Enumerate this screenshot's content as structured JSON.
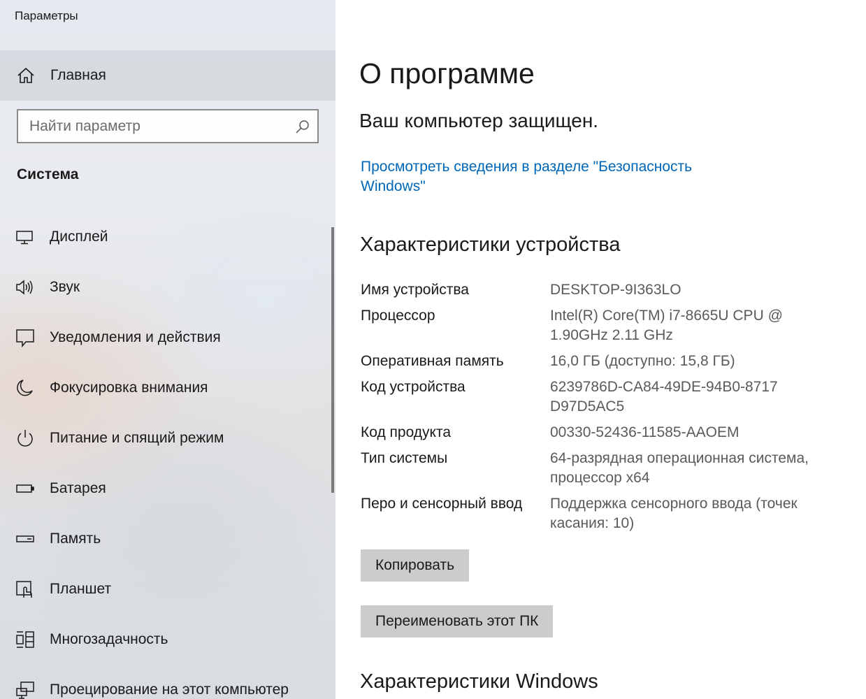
{
  "app": {
    "title": "Параметры"
  },
  "sidebar": {
    "home_label": "Главная",
    "search_placeholder": "Найти параметр",
    "section_title": "Система",
    "items": [
      {
        "label": "Дисплей",
        "icon": "display-icon"
      },
      {
        "label": "Звук",
        "icon": "speaker-icon"
      },
      {
        "label": "Уведомления и действия",
        "icon": "notification-icon"
      },
      {
        "label": "Фокусировка внимания",
        "icon": "moon-icon"
      },
      {
        "label": "Питание и спящий режим",
        "icon": "power-icon"
      },
      {
        "label": "Батарея",
        "icon": "battery-icon"
      },
      {
        "label": "Память",
        "icon": "storage-icon"
      },
      {
        "label": "Планшет",
        "icon": "tablet-icon"
      },
      {
        "label": "Многозадачность",
        "icon": "multitasking-icon"
      },
      {
        "label": "Проецирование на этот компьютер",
        "icon": "projecting-icon"
      }
    ]
  },
  "main": {
    "title": "О программе",
    "protected_text": "Ваш компьютер защищен.",
    "security_link_line1": "Просмотреть сведения в разделе \"Безопасность",
    "security_link_line2": "Windows\"",
    "device_specs_heading": "Характеристики устройства",
    "specs": [
      {
        "label": "Имя устройства",
        "value": "DESKTOP-9I363LO"
      },
      {
        "label": "Процессор",
        "value": "Intel(R) Core(TM) i7-8665U CPU @ 1.90GHz 2.11 GHz"
      },
      {
        "label": "Оперативная память",
        "value": "16,0 ГБ (доступно: 15,8 ГБ)"
      },
      {
        "label": "Код устройства",
        "value": "6239786D-CA84-49DE-94B0-8717D97D5AC5"
      },
      {
        "label": "Код продукта",
        "value": "00330-52436-11585-AAOEM"
      },
      {
        "label": "Тип системы",
        "value": "64-разрядная операционная система, процессор x64"
      },
      {
        "label": "Перо и сенсорный ввод",
        "value": "Поддержка сенсорного ввода (точек касания: 10)"
      }
    ],
    "copy_button": "Копировать",
    "rename_button": "Переименовать этот ПК",
    "windows_specs_heading": "Характеристики Windows"
  },
  "colors": {
    "link": "#0067b8",
    "button_bg": "#cccccc",
    "value_text": "#5a5a5a"
  }
}
